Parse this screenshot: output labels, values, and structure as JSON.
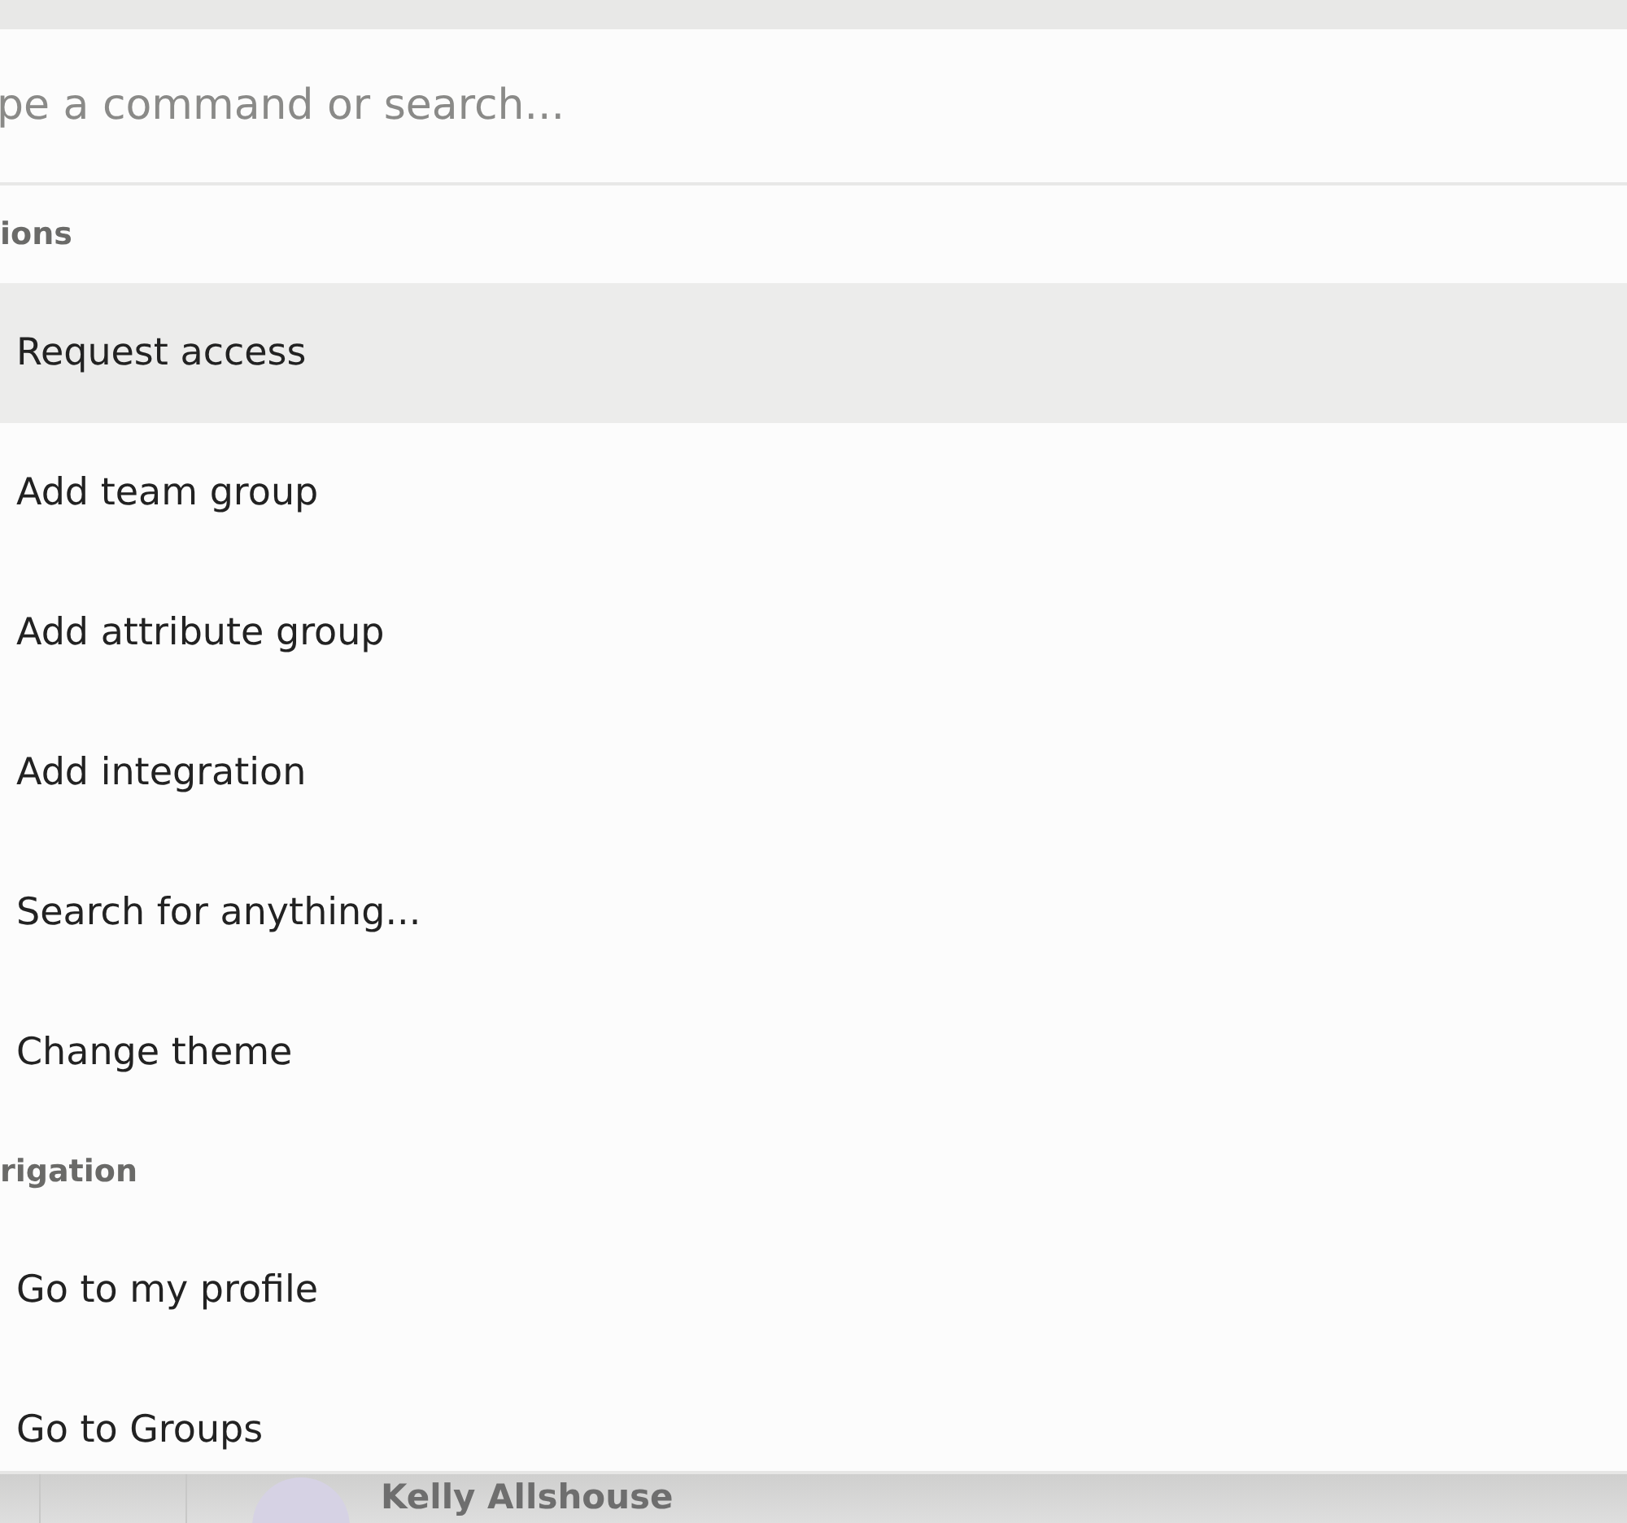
{
  "search": {
    "placeholder": "pe a command or search..."
  },
  "sections": [
    {
      "title": "ions",
      "items": [
        {
          "label": "Request access",
          "selected": true
        },
        {
          "label": "Add team group",
          "selected": false
        },
        {
          "label": "Add attribute group",
          "selected": false
        },
        {
          "label": "Add integration",
          "selected": false
        },
        {
          "label": "Search for anything...",
          "selected": false
        },
        {
          "label": "Change theme",
          "selected": false
        }
      ]
    },
    {
      "title": "rigation",
      "items": [
        {
          "label": "Go to my profile",
          "selected": false
        },
        {
          "label": "Go to Groups",
          "selected": false
        }
      ]
    }
  ],
  "background": {
    "name": "Kelly Allshouse"
  }
}
